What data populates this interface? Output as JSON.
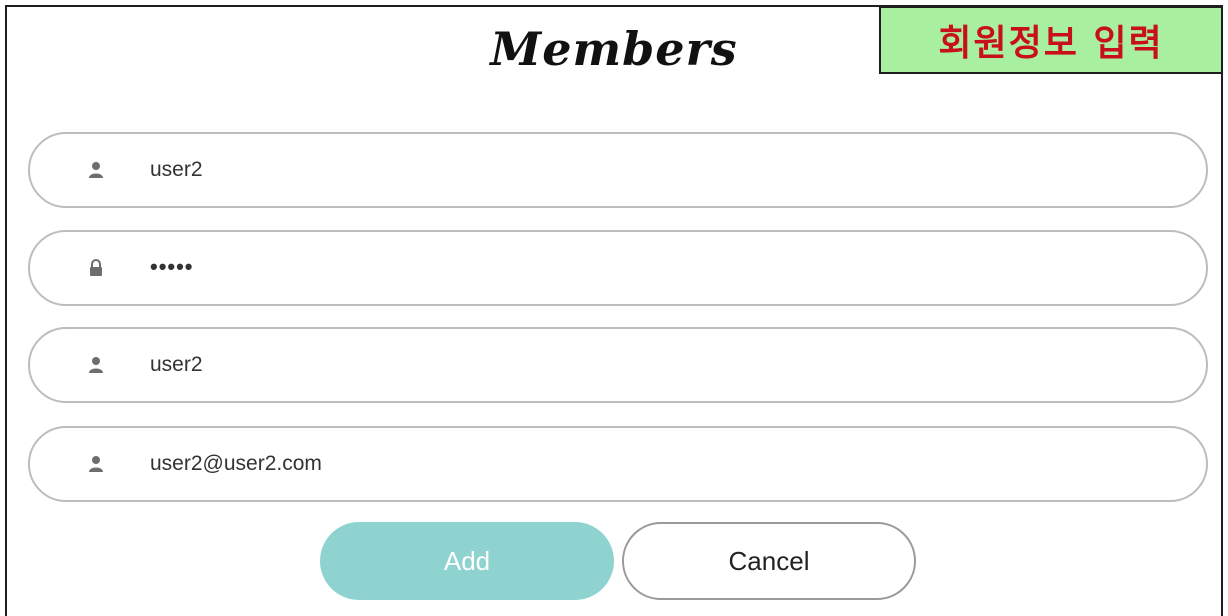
{
  "title": "Members",
  "banner": "회원정보 입력",
  "fields": [
    {
      "icon": "user-icon",
      "value": "user2"
    },
    {
      "icon": "lock-icon",
      "value": "•••••"
    },
    {
      "icon": "user-icon",
      "value": "user2"
    },
    {
      "icon": "user-icon",
      "value": "user2@user2.com"
    }
  ],
  "buttons": {
    "add_label": "Add",
    "cancel_label": "Cancel"
  },
  "colors": {
    "add_button": "#8ed3cf",
    "banner_bg": "#a8f0a0",
    "banner_text": "#c8101c",
    "field_border": "#bdbdbd",
    "icon": "#6e6e6e"
  }
}
